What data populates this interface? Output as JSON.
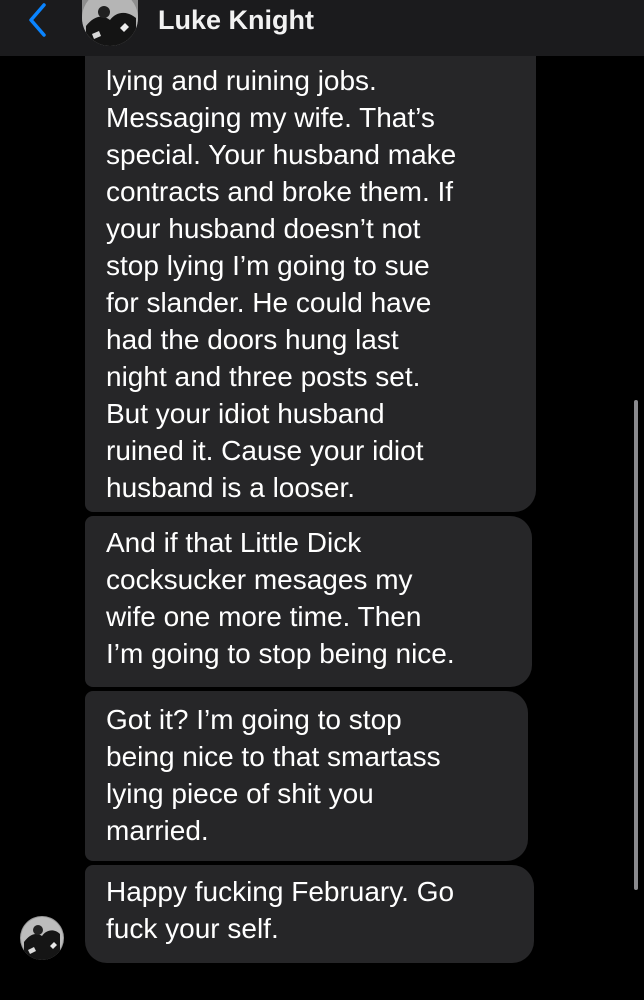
{
  "header": {
    "contact_name": "Luke Knight"
  },
  "messages": [
    {
      "text": "lying and ruining jobs.\nMessaging my wife. That’s\nspecial. Your husband make\ncontracts and broke them. If\nyour husband doesn’t not\nstop lying I’m going to sue\nfor slander. He could have\nhad the doors hung last\nnight and three posts set.\nBut your idiot husband\nruined it. Cause your idiot\nhusband  is a looser."
    },
    {
      "text": "And if that Little Dick\ncocksucker mesages my\nwife one more time. Then\nI’m going to stop being nice."
    },
    {
      "text": "Got it? I’m going to stop\nbeing nice to that smartass\nlying piece of shit you\nmarried."
    },
    {
      "text": "Happy fucking February. Go\nfuck your self."
    }
  ],
  "colors": {
    "background": "#000000",
    "header_bg": "#1b1b1d",
    "bubble_bg": "#262628",
    "accent": "#0a84ff",
    "text": "#ffffff"
  },
  "icons": {
    "back": "chevron-left-icon",
    "avatar": "contact-avatar"
  }
}
